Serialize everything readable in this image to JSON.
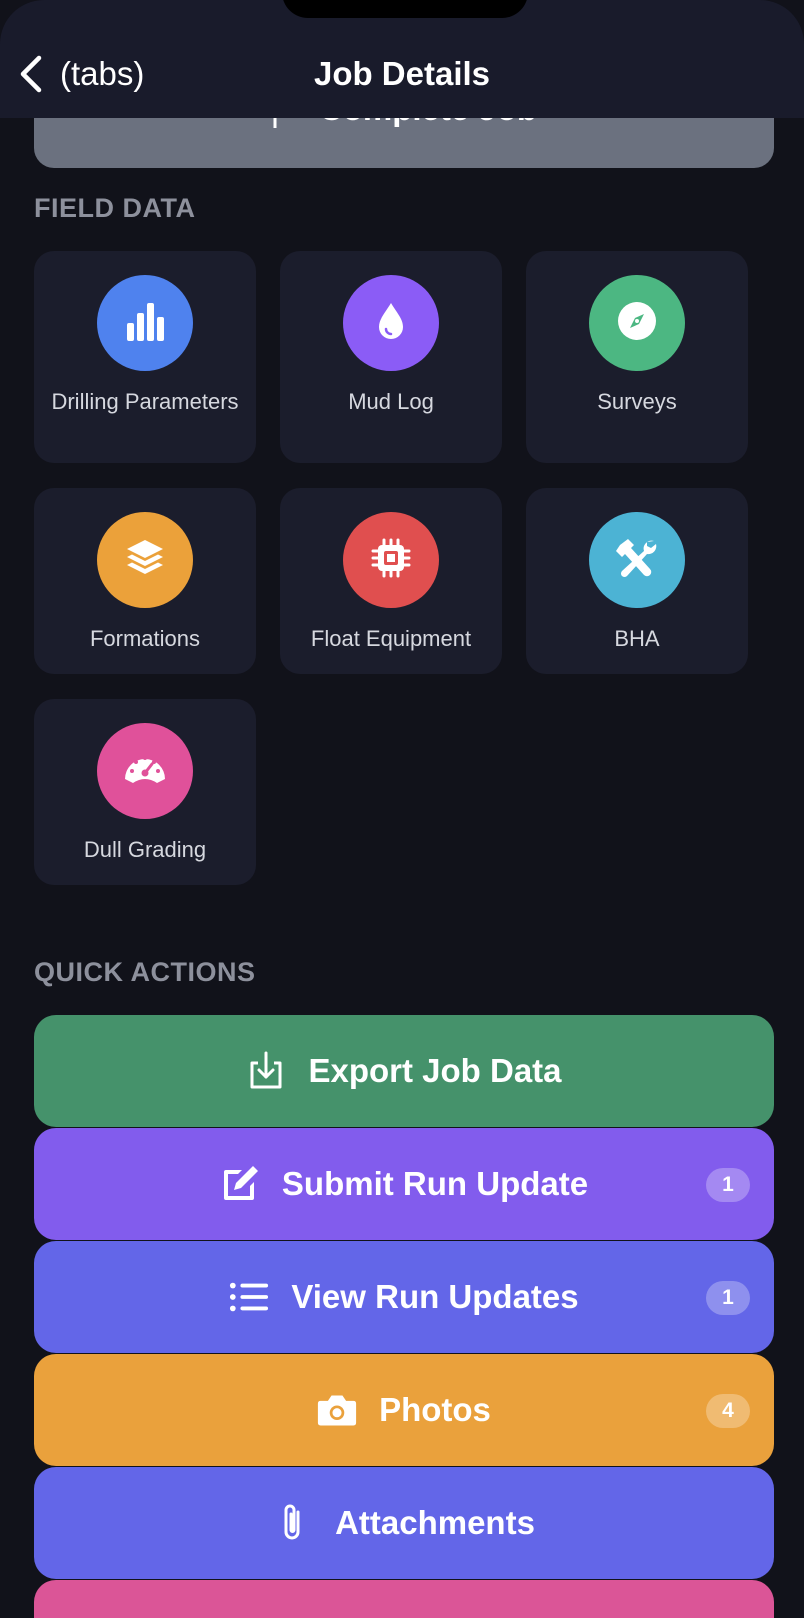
{
  "nav": {
    "back_label": "(tabs)",
    "title": "Job Details"
  },
  "complete_button": {
    "label": "Complete Job",
    "color": "#6b717f"
  },
  "field_data": {
    "heading": "FIELD DATA",
    "tiles": [
      {
        "label": "Drilling Parameters",
        "icon": "bar-chart-icon",
        "color": "#4f82ee"
      },
      {
        "label": "Mud Log",
        "icon": "droplet-icon",
        "color": "#8b5cf6"
      },
      {
        "label": "Surveys",
        "icon": "compass-icon",
        "color": "#4cb782"
      },
      {
        "label": "Formations",
        "icon": "layers-icon",
        "color": "#eba13a"
      },
      {
        "label": "Float Equipment",
        "icon": "chip-icon",
        "color": "#e04f4f"
      },
      {
        "label": "BHA",
        "icon": "tools-icon",
        "color": "#4cb3d4"
      },
      {
        "label": "Dull Grading",
        "icon": "gauge-icon",
        "color": "#e0519a"
      }
    ]
  },
  "quick_actions": {
    "heading": "QUICK ACTIONS",
    "buttons": [
      {
        "label": "Export Job Data",
        "icon": "download-icon",
        "color": "#45926b",
        "badge": ""
      },
      {
        "label": "Submit Run Update",
        "icon": "edit-icon",
        "color": "#825ced",
        "badge": "1"
      },
      {
        "label": "View Run Updates",
        "icon": "list-icon",
        "color": "#6366e8",
        "badge": "1"
      },
      {
        "label": "Photos",
        "icon": "camera-icon",
        "color": "#eaa13c",
        "badge": "4"
      },
      {
        "label": "Attachments",
        "icon": "paperclip-icon",
        "color": "#6366e8",
        "badge": ""
      }
    ],
    "next_button_color": "#db5597"
  }
}
